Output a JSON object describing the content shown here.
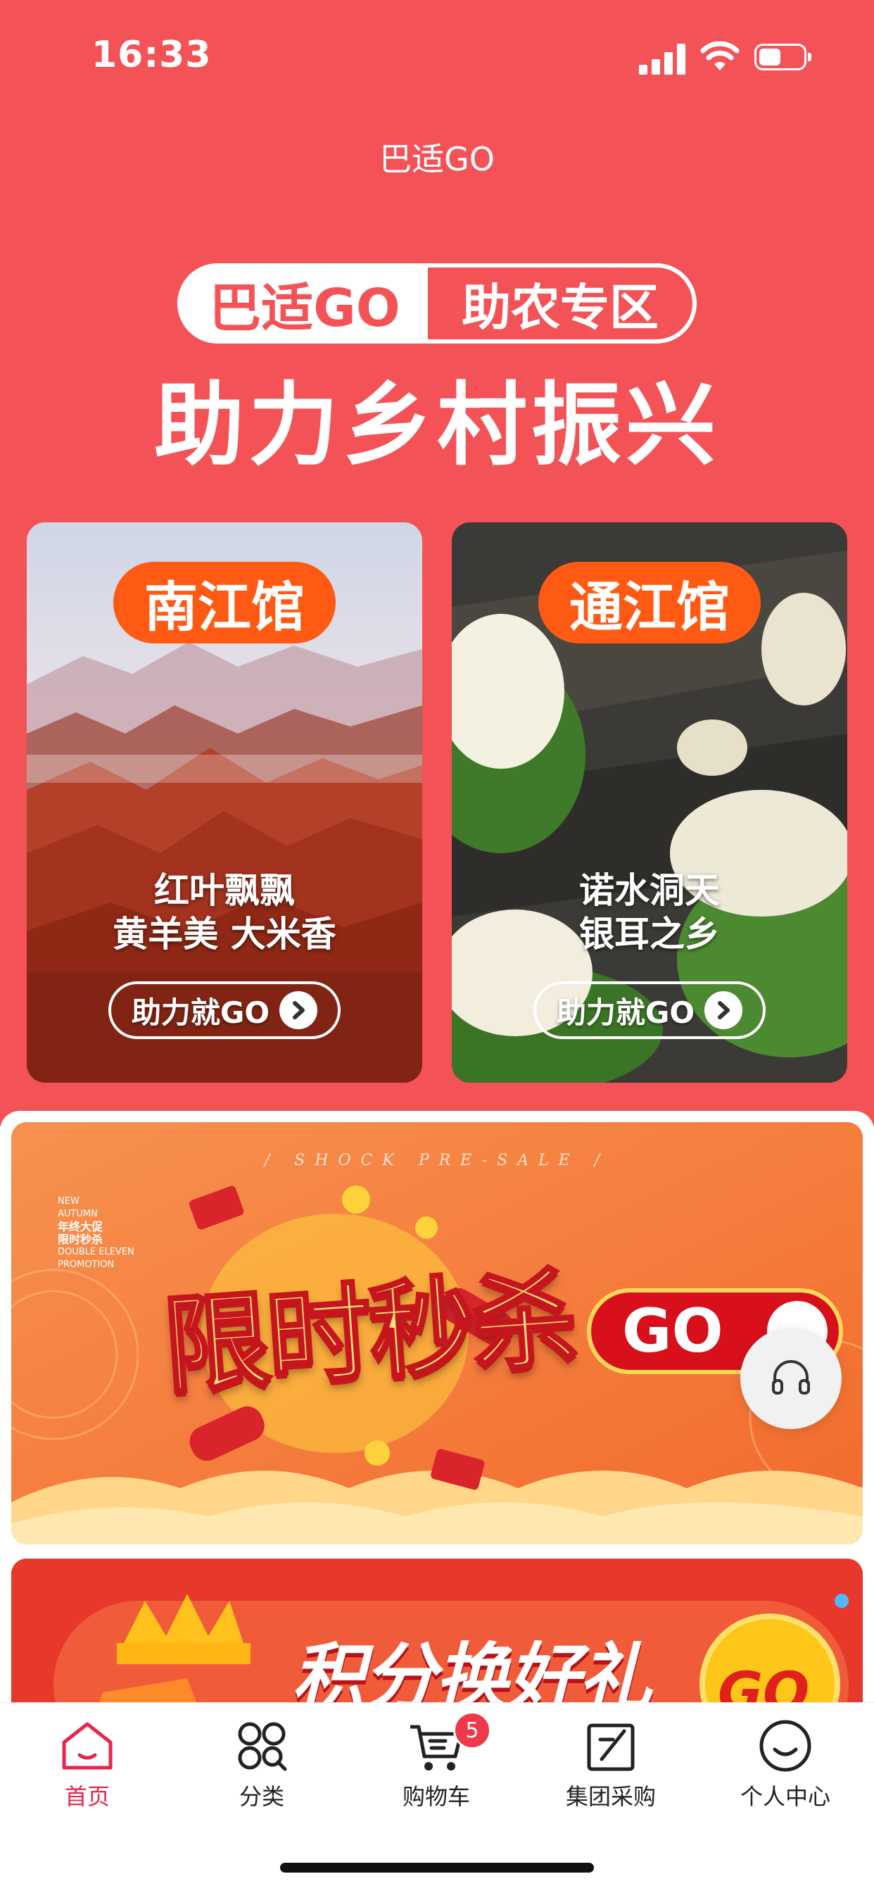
{
  "status_bar": {
    "time": "16:33",
    "battery_level": 0.5
  },
  "header": {
    "title": "巴适GO"
  },
  "hero": {
    "brand": "巴适GO",
    "zone": "助农专区",
    "title": "助力乡村振兴"
  },
  "cards": [
    {
      "name": "南江馆",
      "line1": "红叶飘飘",
      "line2": "黄羊美 大米香",
      "button": "助力就GO"
    },
    {
      "name": "通江馆",
      "line1": "诺水洞天",
      "line2": "银耳之乡",
      "button": "助力就GO"
    }
  ],
  "flash_sale": {
    "subtitle": "/ SHOCK PRE-SALE /",
    "mini_line1": "NEW",
    "mini_line2": "AUTUMN",
    "mini_line3": "年终大促",
    "mini_line4": "限时秒杀",
    "mini_line5": "DOUBLE ELEVEN",
    "mini_line6": "PROMOTION",
    "title": "限时秒杀",
    "go": "GO"
  },
  "points_banner": {
    "title": "积分换好礼",
    "go": "GO"
  },
  "tabbar": {
    "items": [
      {
        "label": "首页",
        "icon": "home-icon",
        "active": true
      },
      {
        "label": "分类",
        "icon": "category-icon"
      },
      {
        "label": "购物车",
        "icon": "cart-icon",
        "badge": "5"
      },
      {
        "label": "集团采购",
        "icon": "purchase-icon"
      },
      {
        "label": "个人中心",
        "icon": "profile-icon"
      }
    ]
  },
  "colors": {
    "primary": "#f35357",
    "accent": "#ff5a14",
    "tab_active": "#e8254a"
  }
}
